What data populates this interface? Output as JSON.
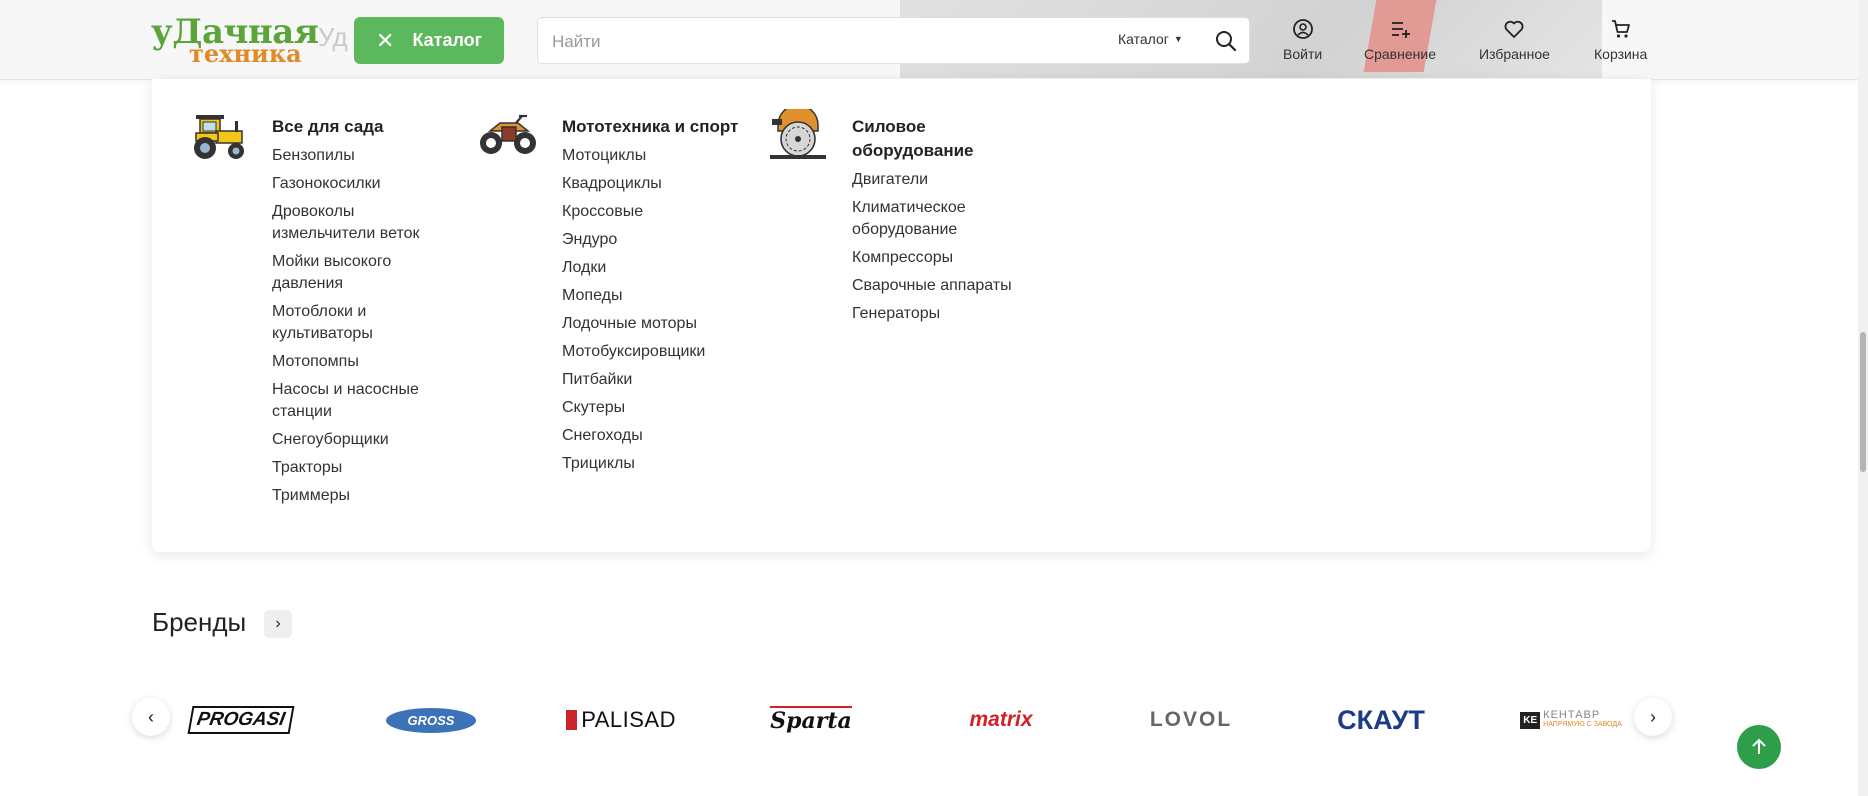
{
  "header": {
    "logo": {
      "line1": "уДачная",
      "line2": "техника"
    },
    "bg_text": "Уд ка?",
    "catalog_button": "Каталог",
    "search": {
      "placeholder": "Найти",
      "scope": "Каталог"
    },
    "actions": [
      {
        "label": "Войти",
        "icon": "user-icon"
      },
      {
        "label": "Сравнение",
        "icon": "compare-icon"
      },
      {
        "label": "Избранное",
        "icon": "heart-icon"
      },
      {
        "label": "Корзина",
        "icon": "cart-icon"
      }
    ]
  },
  "catalog_menu": {
    "columns": [
      {
        "title": "Все для сада",
        "icon": "tractor-icon",
        "items": [
          "Бензопилы",
          "Газонокосилки",
          "Дровоколы измельчители веток",
          "Мойки высокого давления",
          "Мотоблоки и культиваторы",
          "Мотопомпы",
          "Насосы и насосные станции",
          "Снегоуборщики",
          "Тракторы",
          "Триммеры"
        ]
      },
      {
        "title": "Мототехника и спорт",
        "icon": "atv-icon",
        "items": [
          "Мотоциклы",
          "Квадроциклы",
          "Кроссовые",
          "Эндуро",
          "Лодки",
          "Мопеды",
          "Лодочные моторы",
          "Мотобуксировщики",
          "Питбайки",
          "Скутеры",
          "Снегоходы",
          "Трициклы"
        ]
      },
      {
        "title": "Силовое оборудование",
        "icon": "circular-saw-icon",
        "items": [
          "Двигатели",
          "Климатическое оборудование",
          "Компрессоры",
          "Сварочные аппараты",
          "Генераторы"
        ]
      }
    ]
  },
  "brands": {
    "title": "Бренды",
    "logos": [
      "PROGASI",
      "GROSS",
      "PALISAD",
      "Sparta",
      "matrix",
      "LOVOL",
      "СКАУТ",
      "КЕНТАВР"
    ],
    "tagline_kentavr": "НАПРЯМУЮ С ЗАВОДА"
  },
  "colors": {
    "brand_green": "#5cb85c",
    "logo_green": "#5aa43a",
    "logo_orange": "#e08a2a",
    "scroll_top": "#2e9e4b"
  }
}
